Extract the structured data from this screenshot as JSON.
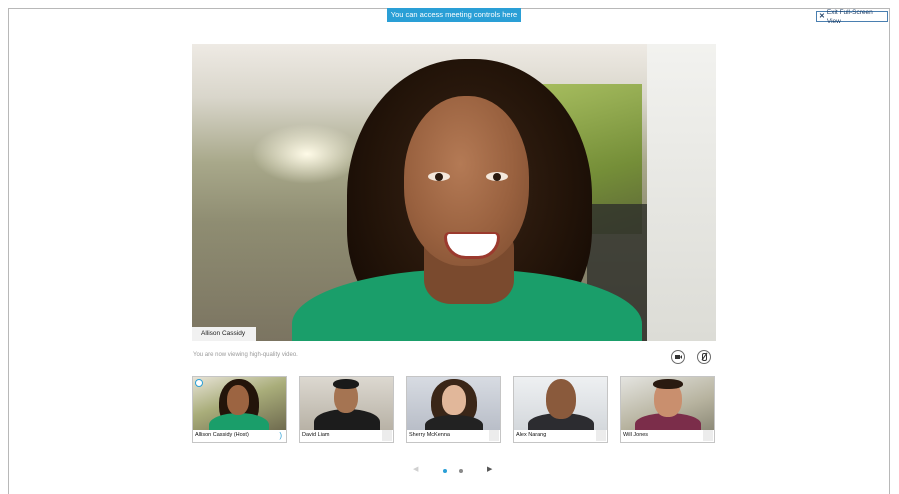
{
  "banner": {
    "text": "You can access meeting controls here"
  },
  "exit_button": {
    "label": "Exit Full-Screen View",
    "icon": "close-icon"
  },
  "main_video": {
    "speaker_name": "Allison Cassidy"
  },
  "quality_notice": "You are now viewing high-quality video.",
  "controls": [
    {
      "name": "camera-button",
      "icon": "camera-icon"
    },
    {
      "name": "mute-button",
      "icon": "mic-muted-icon"
    }
  ],
  "participants": [
    {
      "name": "Allison Cassidy (Host)",
      "active": true
    },
    {
      "name": "David Liam",
      "active": false
    },
    {
      "name": "Sherry McKenna",
      "active": false
    },
    {
      "name": "Alex Narang",
      "active": false
    },
    {
      "name": "Will Jones",
      "active": false
    }
  ],
  "pager": {
    "prev_icon": "chevron-left-icon",
    "next_icon": "chevron-right-icon",
    "pages": 2,
    "current_page": 1
  },
  "colors": {
    "accent": "#2a9fd6",
    "shirt_green": "#1a9e6a"
  }
}
